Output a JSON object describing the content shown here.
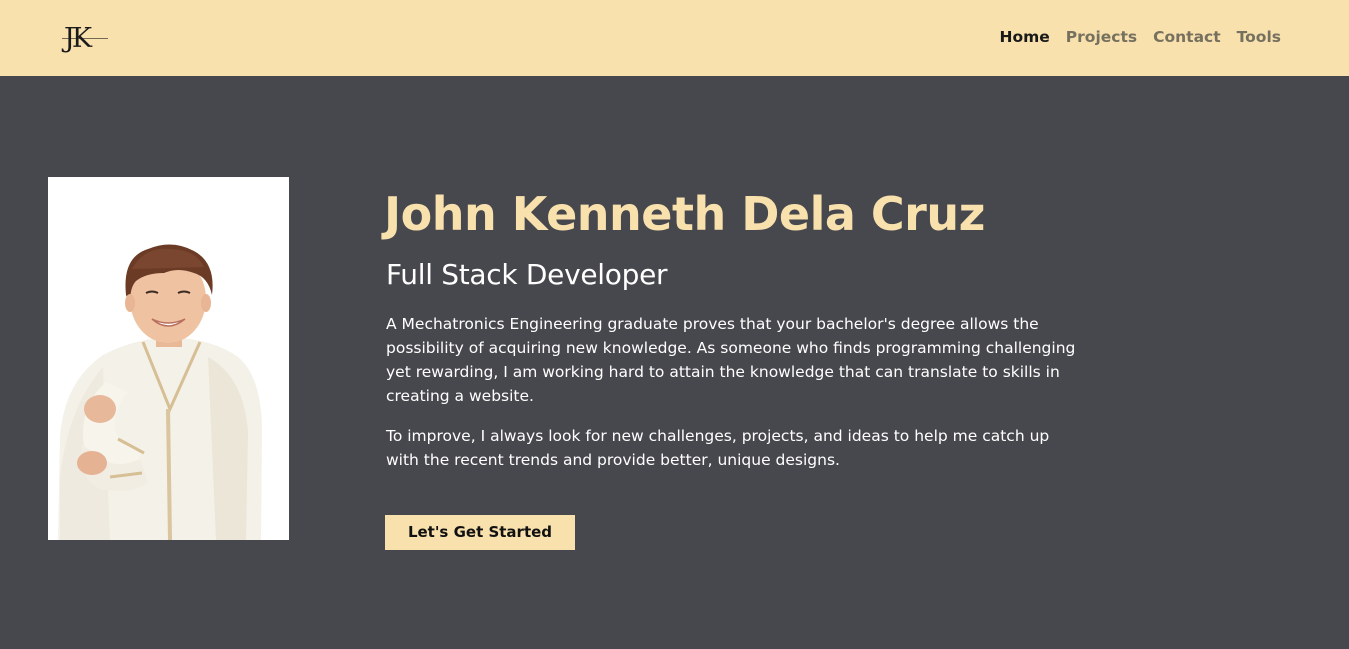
{
  "logo": {
    "text": "JK"
  },
  "nav": {
    "items": [
      {
        "label": "Home",
        "active": true
      },
      {
        "label": "Projects",
        "active": false
      },
      {
        "label": "Contact",
        "active": false
      },
      {
        "label": "Tools",
        "active": false
      }
    ]
  },
  "hero": {
    "name": "John Kenneth Dela Cruz",
    "role": "Full Stack Developer",
    "paragraphs": [
      "A Mechatronics Engineering graduate proves that your bachelor's degree allows the possibility of acquiring new knowledge. As someone who finds programming challenging yet rewarding, I am working hard to attain the knowledge that can translate to skills in creating a website.",
      "To improve, I always look for new challenges, projects, and ideas to help me catch up with the recent trends and provide better, unique designs."
    ],
    "cta_label": "Let's Get Started"
  },
  "colors": {
    "navbar_bg": "#f9e1ae",
    "page_bg": "#47484d",
    "accent": "#f9e1ae",
    "nav_active": "#1a1a1a",
    "nav_inactive": "#76705f"
  }
}
